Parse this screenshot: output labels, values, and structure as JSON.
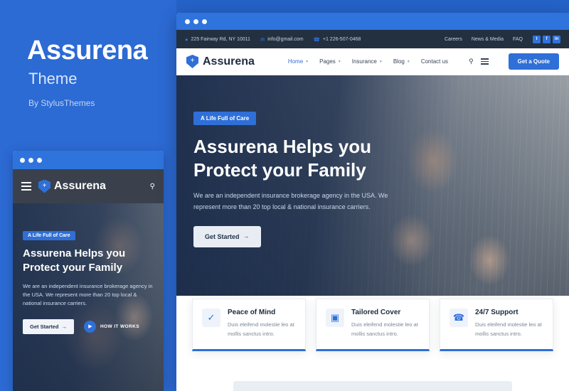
{
  "promo": {
    "title": "Assurena",
    "subtitle": "Theme",
    "author": "By StylusThemes"
  },
  "topbar": {
    "address": "225 Fairway Rd, NY 10011",
    "email": "info@gmail.com",
    "phone": "+1 226-507-0468",
    "links": [
      "Careers",
      "News & Media",
      "FAQ"
    ],
    "socials": [
      "t",
      "f",
      "in"
    ],
    "icons": {
      "location": "location-pin-icon",
      "mail": "envelope-icon",
      "phone": "phone-icon"
    }
  },
  "navbar": {
    "logo_text": "Assurena",
    "links": [
      {
        "label": "Home",
        "caret": true,
        "active": true
      },
      {
        "label": "Pages",
        "caret": true,
        "active": false
      },
      {
        "label": "Insurance",
        "caret": true,
        "active": false
      },
      {
        "label": "Blog",
        "caret": true,
        "active": false
      },
      {
        "label": "Contact us",
        "caret": false,
        "active": false
      }
    ],
    "quote_button": "Get a Quote"
  },
  "hero": {
    "badge": "A Life Full of Care",
    "heading_line1": "Assurena Helps you",
    "heading_line2": "Protect your Family",
    "paragraph": "We are an independent insurance brokerage agency in the USA. We represent more than 20 top local & national insurance carriers.",
    "button": "Get Started",
    "button_arrow": "→"
  },
  "cards": [
    {
      "icon": "check-circle-icon",
      "glyph": "✓",
      "title": "Peace of Mind",
      "text": "Duis eleifend molestie leo at mollis sanctus intro."
    },
    {
      "icon": "shield-user-icon",
      "glyph": "▣",
      "title": "Tailored Cover",
      "text": "Duis eleifend molestie leo at mollis sanctus intro."
    },
    {
      "icon": "headset-support-icon",
      "glyph": "☎",
      "title": "24/7 Support",
      "text": "Duis eleifend molestie leo at mollis sanctus intro."
    }
  ],
  "mobile": {
    "logo_text": "Assurena",
    "badge": "A Life Full of Care",
    "heading_line1": "Assurena Helps you",
    "heading_line2": "Protect your Family",
    "paragraph": "We are an independent insurance brokerage agency in the USA. We represent more than 20 top local & national insurance carriers.",
    "button": "Get Started",
    "button_arrow": "→",
    "play_label": "HOW IT WORKS",
    "play_glyph": "▶"
  },
  "colors": {
    "brand_blue": "#2f6fd8",
    "page_blue": "#2c6ad4",
    "dark_navy": "#23303f",
    "text_dark": "#1d2b3e"
  }
}
